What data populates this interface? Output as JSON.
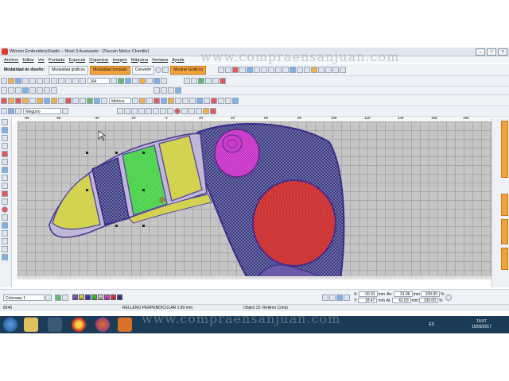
{
  "window": {
    "title": "Wilcom EmbroideryStudio – Nivel 3 Avanzado - [Toucan        Melco Chenille]",
    "min": "_",
    "max": "□",
    "close": "x"
  },
  "menu": [
    "Archivo",
    "Editar",
    "Ver",
    "Puntada",
    "Especial",
    "Organizar",
    "Imagen",
    "Máquina",
    "Ventana",
    "Ayuda"
  ],
  "modes": {
    "diseno": "Modalidad de diseño:",
    "graficos": "Modalidad gráficos",
    "bordado": "Modalidad bordado",
    "convertir": "Convertir",
    "mostrar": "Mostrar Gráficos"
  },
  "toolbar": {
    "zoom_value": "164",
    "units": "Métrico",
    "fabric": "Ninguno"
  },
  "ruler": {
    "labels": [
      "-80",
      "-60",
      "-40",
      "-20",
      "0",
      "20",
      "40",
      "60",
      "80",
      "100",
      "120",
      "140",
      "160",
      "180",
      "200"
    ]
  },
  "colorway": {
    "name": "Colorway 1",
    "swatches": [
      {
        "n": "1",
        "color": "#8a4bd4"
      },
      {
        "n": "2",
        "color": "#d9d93a"
      },
      {
        "n": "3",
        "color": "#3a3ac8"
      },
      {
        "n": "4",
        "color": "#35c835"
      },
      {
        "n": "5",
        "color": "#d0d0d0"
      },
      {
        "n": "6",
        "color": "#e03ad8"
      },
      {
        "n": "7",
        "color": "#e03a3a"
      },
      {
        "n": "8",
        "color": "#3a3a9a"
      }
    ]
  },
  "coords": {
    "x_label": "X:",
    "x": "-26.91",
    "y_label": "Y:",
    "y": "18.47",
    "unit": "mm",
    "an_label": "An:",
    "an": "31.96",
    "al_label": "Al:",
    "al": "41.63",
    "pct1": "100.00",
    "pct2": "100.00",
    "pct_unit": "%"
  },
  "status": {
    "stitches": "8246",
    "fill": "RELLENO PERPENDICULAR  1.80 mm",
    "object": "Object 22: Relleno Comp"
  },
  "taskbar": {
    "lang": "ES",
    "time": "16:57",
    "date": "15/09/2017"
  },
  "watermark": "www.compraensanjuan.com"
}
